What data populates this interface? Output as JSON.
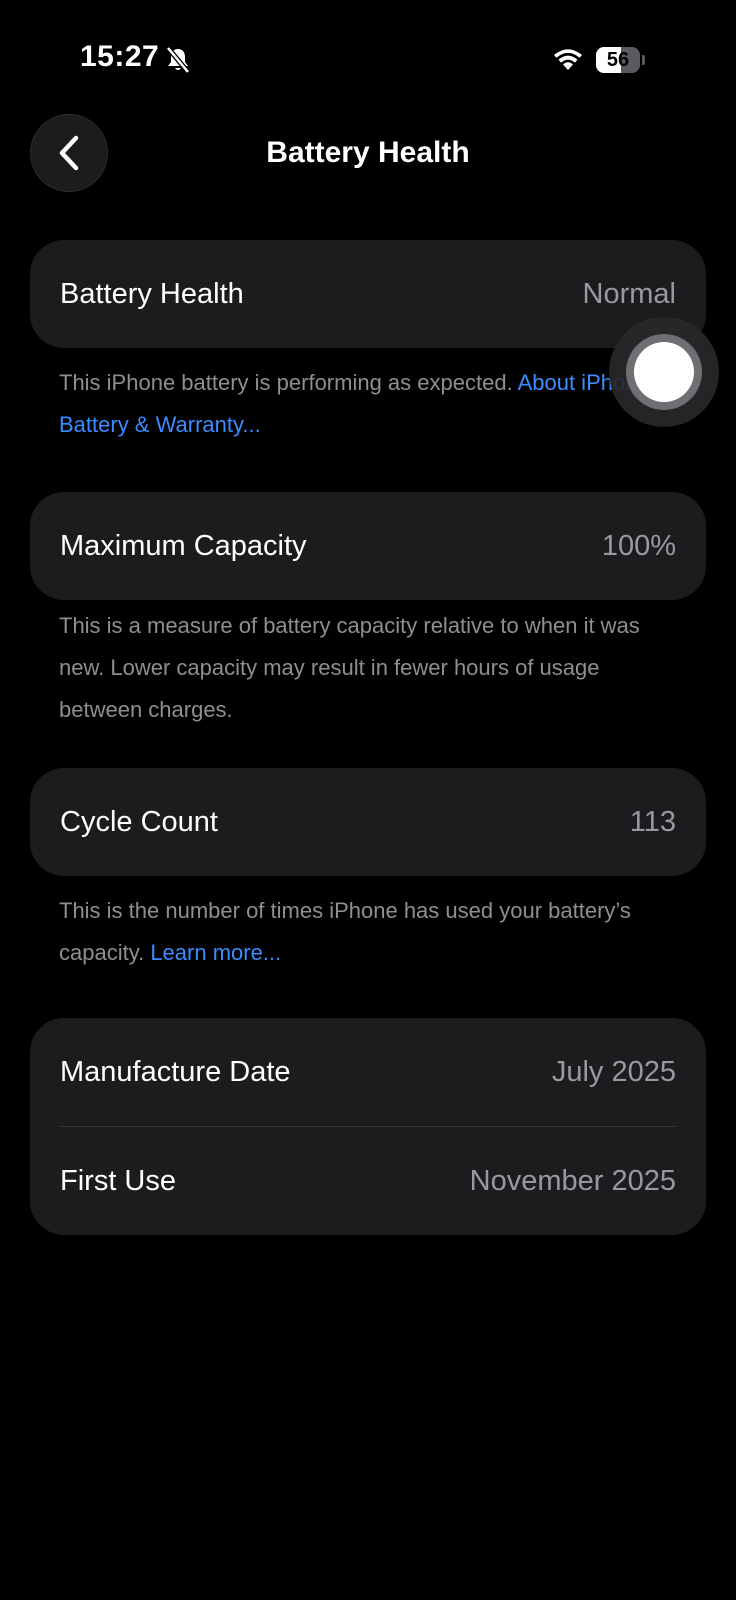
{
  "status_bar": {
    "time": "15:27",
    "battery_level": "56",
    "battery_fraction": 0.56,
    "icons": [
      "bell-slash-icon",
      "wifi-icon",
      "battery-icon"
    ]
  },
  "nav": {
    "title": "Battery Health",
    "back_icon": "chevron-left-icon"
  },
  "battery_health": {
    "label": "Battery Health",
    "value": "Normal",
    "footnote_text": "This iPhone battery is performing as expected. ",
    "footnote_link": "About iPhone Battery & Warranty..."
  },
  "max_capacity": {
    "label": "Maximum Capacity",
    "value": "100%",
    "footnote_text": "This is a measure of battery capacity relative to when it was new. Lower capacity may result in fewer hours of usage between charges."
  },
  "cycle_count": {
    "label": "Cycle Count",
    "value": "113",
    "footnote_text": "This is the number of times iPhone has used your battery’s capacity. ",
    "footnote_link": "Learn more..."
  },
  "dates": {
    "manufacture_label": "Manufacture Date",
    "manufacture_value": "July 2025",
    "first_use_label": "First Use",
    "first_use_value": "November 2025"
  },
  "colors": {
    "background": "#000000",
    "card": "#1c1c1e",
    "secondary_text": "#98989f",
    "link": "#3a8cff"
  }
}
